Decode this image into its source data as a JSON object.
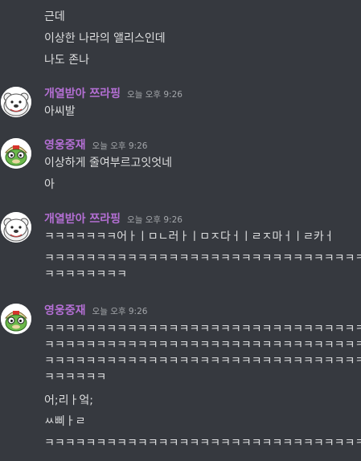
{
  "messages": [
    {
      "continuation": true,
      "lines": [
        "근데",
        "이상한 나라의 앨리스인데",
        "나도 존나"
      ]
    },
    {
      "username": "개열받아 쯔라핑",
      "timestamp": "오늘 오후 9:26",
      "avatar": "white-bear-avatar",
      "lines": [
        "아씨발"
      ]
    },
    {
      "username": "영웅중재",
      "timestamp": "오늘 오후 9:26",
      "avatar": "green-frog-avatar",
      "lines": [
        "이상하게 줄여부르고잇엇네",
        "아"
      ]
    },
    {
      "username": "개열받아 쯔라핑",
      "timestamp": "오늘 오후 9:26",
      "avatar": "white-bear-avatar",
      "lines": [
        "ㅋㅋㅋㅋㅋㅋㅋ어ㅏㅣㅁㄴ러ㅏㅣㅁㅈ다ㅓㅣㄹㅈ마ㅓㅣㄹ카ㅓ",
        "ㅋㅋㅋㅋㅋㅋㅋㅋㅋㅋㅋㅋㅋㅋㅋㅋㅋㅋㅋㅋㅋㅋㅋㅋㅋㅋㅋㅋㅋㅋㅋㅋㅋㅋㅋ",
        "ㅋㅋㅋㅋㅋㅋㅋㅋ"
      ]
    },
    {
      "username": "영웅중재",
      "timestamp": "오늘 오후 9:26",
      "avatar": "green-frog-avatar",
      "lines": [
        "ㅋㅋㅋㅋㅋㅋㅋㅋㅋㅋㅋㅋㅋㅋㅋㅋㅋㅋㅋㅋㅋㅋㅋㅋㅋㅋㅋㅋㅋㅋㅋㅋㅋㅋㅋ",
        "ㅋㅋㅋㅋㅋㅋㅋㅋㅋㅋㅋㅋㅋㅋㅋㅋㅋㅋㅋㅋㅋㅋㅋㅋㅋㅋㅋㅋㅋㅋㅋㅋㅋㅋㅋ",
        "ㅋㅋㅋㅋㅋㅋㅋㅋㅋㅋㅋㅋㅋㅋㅋㅋㅋㅋㅋㅋㅋㅋㅋㅋㅋㅋㅋㅋㅋㅋㅋㅋㅋㅋㅋ",
        "ㅋㅋㅋㅋㅋㅋ",
        "어;리ㅏ엌;",
        "ㅆ삐ㅏㄹ",
        "ㅋㅋㅋㅋㅋㅋㅋㅋㅋㅋㅋㅋㅋㅋㅋㅋㅋㅋㅋㅋㅋㅋㅋㅋㅋㅋㅋㅋㅋㅋㅋㅋㅋㅋㅋ"
      ]
    }
  ],
  "colors": {
    "background": "#36393f",
    "username": "#b46fd4",
    "text": "#dcddde",
    "timestamp": "#a3a6aa"
  }
}
